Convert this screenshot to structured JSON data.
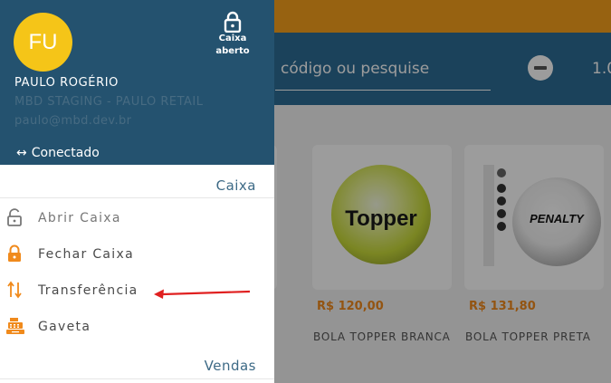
{
  "background": {
    "search_text": "código ou pesquise",
    "qty_text": "1.0",
    "products": [
      {
        "price": "R$ 120,00",
        "name": "BOLA TOPPER BRANCA",
        "brand": "Topper"
      },
      {
        "price": "R$ 131,80",
        "name": "BOLA TOPPER PRETA",
        "brand": "PENALTY"
      }
    ]
  },
  "drawer": {
    "avatar_initials": "FU",
    "cash_status": {
      "line1": "Caixa",
      "line2": "aberto",
      "icon": "lock-icon"
    },
    "user_name": "PAULO ROGÉRIO",
    "user_company": "MBD STAGING - PAULO RETAIL",
    "user_email": "paulo@mbd.dev.br",
    "connection_status": "Conectado",
    "connection_icon": "swap-horizontal-icon",
    "sections": {
      "caixa": "Caixa",
      "vendas": "Vendas"
    },
    "menu": [
      {
        "label": "Abrir Caixa",
        "icon": "lock-open-icon"
      },
      {
        "label": "Fechar Caixa",
        "icon": "lock-icon"
      },
      {
        "label": "Transferência",
        "icon": "swap-vertical-icon"
      },
      {
        "label": "Gaveta",
        "icon": "cash-register-icon"
      }
    ]
  },
  "colors": {
    "accent_orange": "#f7a01c",
    "header_blue": "#24526f",
    "avatar_yellow": "#f5c518",
    "menu_icon_orange": "#f08a1c",
    "annotation_arrow": "#e02020"
  }
}
